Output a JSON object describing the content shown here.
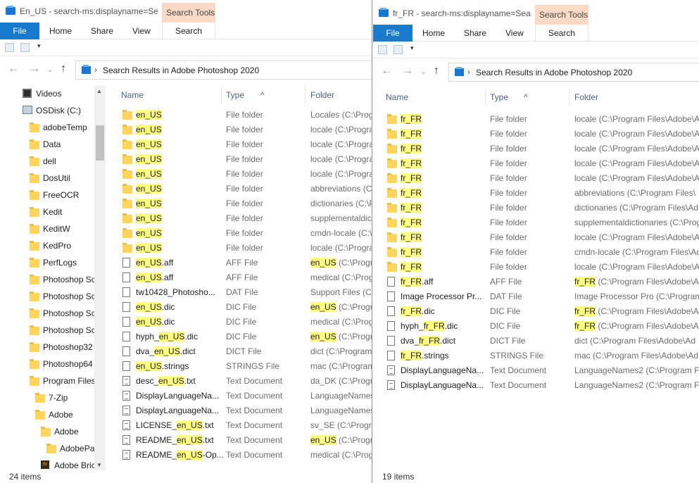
{
  "windows": [
    {
      "title": "En_US - search-ms:displayname=Se...",
      "ribbon": {
        "file": "File",
        "tabs": [
          "Home",
          "Share",
          "View"
        ],
        "context_group": "Search Tools",
        "context_tab": "Search"
      },
      "address": "Search Results in Adobe Photoshop 2020",
      "headers": {
        "name": "Name",
        "type": "Type",
        "folder": "Folder"
      },
      "status": "24 items",
      "nav": [
        {
          "label": "Videos",
          "icon": "video-icon"
        },
        {
          "label": "OSDisk (C:)",
          "icon": "drive-icon"
        },
        {
          "label": "adobeTemp",
          "icon": "folder-icon"
        },
        {
          "label": "Data",
          "icon": "folder-icon"
        },
        {
          "label": "dell",
          "icon": "folder-icon"
        },
        {
          "label": "DosUtil",
          "icon": "folder-icon"
        },
        {
          "label": "FreeOCR",
          "icon": "folder-icon"
        },
        {
          "label": "Kedit",
          "icon": "folder-icon"
        },
        {
          "label": "KeditW",
          "icon": "folder-icon"
        },
        {
          "label": "KedPro",
          "icon": "folder-icon"
        },
        {
          "label": "PerfLogs",
          "icon": "folder-icon"
        },
        {
          "label": "Photoshop Sc",
          "icon": "folder-icon"
        },
        {
          "label": "Photoshop Sc",
          "icon": "folder-icon"
        },
        {
          "label": "Photoshop Sc",
          "icon": "folder-icon"
        },
        {
          "label": "Photoshop Sc",
          "icon": "folder-icon"
        },
        {
          "label": "Photoshop32",
          "icon": "folder-icon"
        },
        {
          "label": "Photoshop64",
          "icon": "folder-icon"
        },
        {
          "label": "Program Files",
          "icon": "folder-icon"
        },
        {
          "label": "7-Zip",
          "icon": "folder-icon"
        },
        {
          "label": "Adobe",
          "icon": "folder-icon"
        },
        {
          "label": "Adobe",
          "icon": "folder-icon"
        },
        {
          "label": "AdobePa",
          "icon": "folder-icon"
        },
        {
          "label": "Adobe Bric",
          "icon": "bridge-icon"
        }
      ],
      "rows": [
        {
          "icon": "folder-icon",
          "name": [
            "",
            "en_US",
            ""
          ],
          "type": "File folder",
          "folder": [
            "",
            "",
            "Locales (C:\\Prog"
          ]
        },
        {
          "icon": "folder-icon",
          "name": [
            "",
            "en_US",
            ""
          ],
          "type": "File folder",
          "folder": [
            "",
            "",
            "locale (C:\\Progra"
          ]
        },
        {
          "icon": "folder-icon",
          "name": [
            "",
            "en_US",
            ""
          ],
          "type": "File folder",
          "folder": [
            "",
            "",
            "locale (C:\\Progra"
          ]
        },
        {
          "icon": "folder-icon",
          "name": [
            "",
            "en_US",
            ""
          ],
          "type": "File folder",
          "folder": [
            "",
            "",
            "locale (C:\\Progra"
          ]
        },
        {
          "icon": "folder-icon",
          "name": [
            "",
            "en_US",
            ""
          ],
          "type": "File folder",
          "folder": [
            "",
            "",
            "locale (C:\\Progra"
          ]
        },
        {
          "icon": "folder-icon",
          "name": [
            "",
            "en_US",
            ""
          ],
          "type": "File folder",
          "folder": [
            "",
            "",
            "abbreviations (C:"
          ]
        },
        {
          "icon": "folder-icon",
          "name": [
            "",
            "en_US",
            ""
          ],
          "type": "File folder",
          "folder": [
            "",
            "",
            "dictionaries (C:\\P"
          ]
        },
        {
          "icon": "folder-icon",
          "name": [
            "",
            "en_US",
            ""
          ],
          "type": "File folder",
          "folder": [
            "",
            "",
            "supplementaldic"
          ]
        },
        {
          "icon": "folder-icon",
          "name": [
            "",
            "en_US",
            ""
          ],
          "type": "File folder",
          "folder": [
            "",
            "",
            "cmdn-locale (C:\\"
          ]
        },
        {
          "icon": "folder-icon",
          "name": [
            "",
            "en_US",
            ""
          ],
          "type": "File folder",
          "folder": [
            "",
            "",
            "locale (C:\\Progra"
          ]
        },
        {
          "icon": "doc-icon",
          "name": [
            "",
            "en_US",
            ".aff"
          ],
          "type": "AFF File",
          "folder": [
            "",
            "en_US",
            " (C:\\Progra"
          ]
        },
        {
          "icon": "doc-icon",
          "name": [
            "",
            "en_US",
            ".aff"
          ],
          "type": "AFF File",
          "folder": [
            "",
            "",
            "medical (C:\\Progra"
          ]
        },
        {
          "icon": "doc-icon",
          "name": [
            "tw10428_Photosho...",
            "",
            ""
          ],
          "type": "DAT File",
          "folder": [
            "",
            "",
            "Support Files (C:\\"
          ]
        },
        {
          "icon": "doc-icon",
          "name": [
            "",
            "en_US",
            ".dic"
          ],
          "type": "DIC File",
          "folder": [
            "",
            "en_US",
            " (C:\\Progra"
          ]
        },
        {
          "icon": "doc-icon",
          "name": [
            "",
            "en_US",
            ".dic"
          ],
          "type": "DIC File",
          "folder": [
            "",
            "",
            "medical (C:\\Progra"
          ]
        },
        {
          "icon": "doc-icon",
          "name": [
            "hyph_",
            "en_US",
            ".dic"
          ],
          "type": "DIC File",
          "folder": [
            "",
            "en_US",
            " (C:\\Progra"
          ]
        },
        {
          "icon": "doc-icon",
          "name": [
            "dva_",
            "en_US",
            ".dict"
          ],
          "type": "DICT File",
          "folder": [
            "",
            "",
            "dict (C:\\Program"
          ]
        },
        {
          "icon": "doc-icon",
          "name": [
            "",
            "en_US",
            ".strings"
          ],
          "type": "STRINGS File",
          "folder": [
            "",
            "",
            "mac (C:\\Program"
          ]
        },
        {
          "icon": "text-icon",
          "name": [
            "desc_",
            "en_US",
            ".txt"
          ],
          "type": "Text Document",
          "folder": [
            "",
            "",
            "da_DK (C:\\Progra"
          ]
        },
        {
          "icon": "text-icon",
          "name": [
            "DisplayLanguageNa...",
            "",
            ""
          ],
          "type": "Text Document",
          "folder": [
            "",
            "",
            "LanguageNames"
          ]
        },
        {
          "icon": "text-icon",
          "name": [
            "DisplayLanguageNa...",
            "",
            ""
          ],
          "type": "Text Document",
          "folder": [
            "",
            "",
            "LanguageNames"
          ]
        },
        {
          "icon": "text-icon",
          "name": [
            "LICENSE_",
            "en_US",
            ".txt"
          ],
          "type": "Text Document",
          "folder": [
            "",
            "",
            "sv_SE (C:\\Progra"
          ]
        },
        {
          "icon": "text-icon",
          "name": [
            "README_",
            "en_US",
            ".txt"
          ],
          "type": "Text Document",
          "folder": [
            "",
            "en_US",
            " (C:\\Progra"
          ]
        },
        {
          "icon": "text-icon",
          "name": [
            "README_",
            "en_US",
            "-Op..."
          ],
          "type": "Text Document",
          "folder": [
            "",
            "",
            "medical (C:\\Progra"
          ]
        }
      ]
    },
    {
      "title": "fr_FR - search-ms:displayname=Sea...",
      "ribbon": {
        "file": "File",
        "tabs": [
          "Home",
          "Share",
          "View"
        ],
        "context_group": "Search Tools",
        "context_tab": "Search"
      },
      "address": "Search Results in Adobe Photoshop 2020",
      "headers": {
        "name": "Name",
        "type": "Type",
        "folder": "Folder"
      },
      "status": "19 items",
      "nav": [],
      "rows": [
        {
          "icon": "folder-icon",
          "name": [
            "",
            "fr_FR",
            ""
          ],
          "type": "File folder",
          "folder": [
            "",
            "",
            "locale (C:\\Program Files\\Adobe\\A"
          ]
        },
        {
          "icon": "folder-icon",
          "name": [
            "",
            "fr_FR",
            ""
          ],
          "type": "File folder",
          "folder": [
            "",
            "",
            "locale (C:\\Program Files\\Adobe\\A"
          ]
        },
        {
          "icon": "folder-icon",
          "name": [
            "",
            "fr_FR",
            ""
          ],
          "type": "File folder",
          "folder": [
            "",
            "",
            "locale (C:\\Program Files\\Adobe\\A"
          ]
        },
        {
          "icon": "folder-icon",
          "name": [
            "",
            "fr_FR",
            ""
          ],
          "type": "File folder",
          "folder": [
            "",
            "",
            "locale (C:\\Program Files\\Adobe\\A"
          ]
        },
        {
          "icon": "folder-icon",
          "name": [
            "",
            "fr_FR",
            ""
          ],
          "type": "File folder",
          "folder": [
            "",
            "",
            "locale (C:\\Program Files\\Adobe\\A"
          ]
        },
        {
          "icon": "folder-icon",
          "name": [
            "",
            "fr_FR",
            ""
          ],
          "type": "File folder",
          "folder": [
            "",
            "",
            "abbreviations (C:\\Program Files\\"
          ]
        },
        {
          "icon": "folder-icon",
          "name": [
            "",
            "fr_FR",
            ""
          ],
          "type": "File folder",
          "folder": [
            "",
            "",
            "dictionaries (C:\\Program Files\\Ad"
          ]
        },
        {
          "icon": "folder-icon",
          "name": [
            "",
            "fr_FR",
            ""
          ],
          "type": "File folder",
          "folder": [
            "",
            "",
            "supplementaldictionaries (C:\\Prog"
          ]
        },
        {
          "icon": "folder-icon",
          "name": [
            "",
            "fr_FR",
            ""
          ],
          "type": "File folder",
          "folder": [
            "",
            "",
            "locale (C:\\Program Files\\Adobe\\A"
          ]
        },
        {
          "icon": "folder-icon",
          "name": [
            "",
            "fr_FR",
            ""
          ],
          "type": "File folder",
          "folder": [
            "",
            "",
            "cmdn-locale (C:\\Program Files\\Ad"
          ]
        },
        {
          "icon": "folder-icon",
          "name": [
            "",
            "fr_FR",
            ""
          ],
          "type": "File folder",
          "folder": [
            "",
            "",
            "locale (C:\\Program Files\\Adobe\\A"
          ]
        },
        {
          "icon": "doc-icon",
          "name": [
            "",
            "fr_FR",
            ".aff"
          ],
          "type": "AFF File",
          "folder": [
            "",
            "fr_FR",
            " (C:\\Program Files\\Adobe\\Ad"
          ]
        },
        {
          "icon": "doc-icon",
          "name": [
            "Image Processor Pr...",
            "",
            ""
          ],
          "type": "DAT File",
          "folder": [
            "",
            "",
            "Image Processor Pro (C:\\Program"
          ]
        },
        {
          "icon": "doc-icon",
          "name": [
            "",
            "fr_FR",
            ".dic"
          ],
          "type": "DIC File",
          "folder": [
            "",
            "fr_FR",
            " (C:\\Program Files\\Adobe\\Ad"
          ]
        },
        {
          "icon": "doc-icon",
          "name": [
            "hyph_",
            "fr_FR",
            ".dic"
          ],
          "type": "DIC File",
          "folder": [
            "",
            "fr_FR",
            " (C:\\Program Files\\Adobe\\Ad"
          ]
        },
        {
          "icon": "doc-icon",
          "name": [
            "dva_",
            "fr_FR",
            ".dict"
          ],
          "type": "DICT File",
          "folder": [
            "",
            "",
            "dict (C:\\Program Files\\Adobe\\Ad"
          ]
        },
        {
          "icon": "doc-icon",
          "name": [
            "",
            "fr_FR",
            ".strings"
          ],
          "type": "STRINGS File",
          "folder": [
            "",
            "",
            "mac (C:\\Program Files\\Adobe\\Ad"
          ]
        },
        {
          "icon": "text-icon",
          "name": [
            "DisplayLanguageNa...",
            "",
            ""
          ],
          "type": "Text Document",
          "folder": [
            "",
            "",
            "LanguageNames2 (C:\\Program Fi"
          ]
        },
        {
          "icon": "text-icon",
          "name": [
            "DisplayLanguageNa...",
            "",
            ""
          ],
          "type": "Text Document",
          "folder": [
            "",
            "",
            "LanguageNames2 (C:\\Program Fi"
          ]
        }
      ]
    }
  ]
}
